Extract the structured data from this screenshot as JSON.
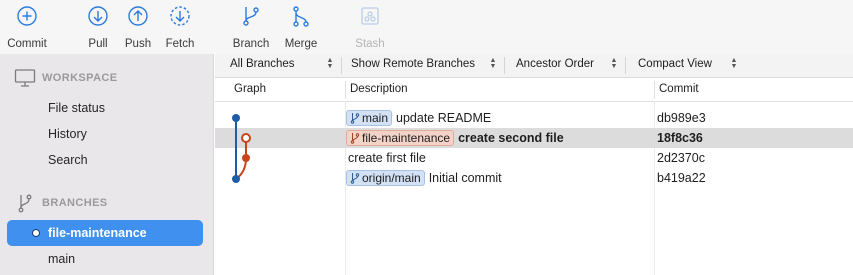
{
  "toolbar": {
    "commit": "Commit",
    "pull": "Pull",
    "push": "Push",
    "fetch": "Fetch",
    "branch": "Branch",
    "merge": "Merge",
    "stash": "Stash"
  },
  "sidebar": {
    "workspace_header": "WORKSPACE",
    "workspace_items": [
      "File status",
      "History",
      "Search"
    ],
    "branches_header": "BRANCHES",
    "branches": [
      "file-maintenance",
      "main"
    ]
  },
  "filters": {
    "branches": "All Branches",
    "remote": "Show Remote Branches",
    "order": "Ancestor Order",
    "view": "Compact View"
  },
  "columns": {
    "graph": "Graph",
    "description": "Description",
    "commit": "Commit"
  },
  "commits": [
    {
      "tag": "main",
      "message": "update README",
      "hash": "db989e3"
    },
    {
      "tag": "file-maintenance",
      "message": "create second file",
      "hash": "18f8c36"
    },
    {
      "tag": "",
      "message": "create first file",
      "hash": "2d2370c"
    },
    {
      "tag": "origin/main",
      "message": "Initial commit",
      "hash": "b419a22"
    }
  ],
  "colors": {
    "accent": "#3f90ef",
    "graph_main": "#1f5ca8",
    "graph_branch": "#c9441b"
  }
}
